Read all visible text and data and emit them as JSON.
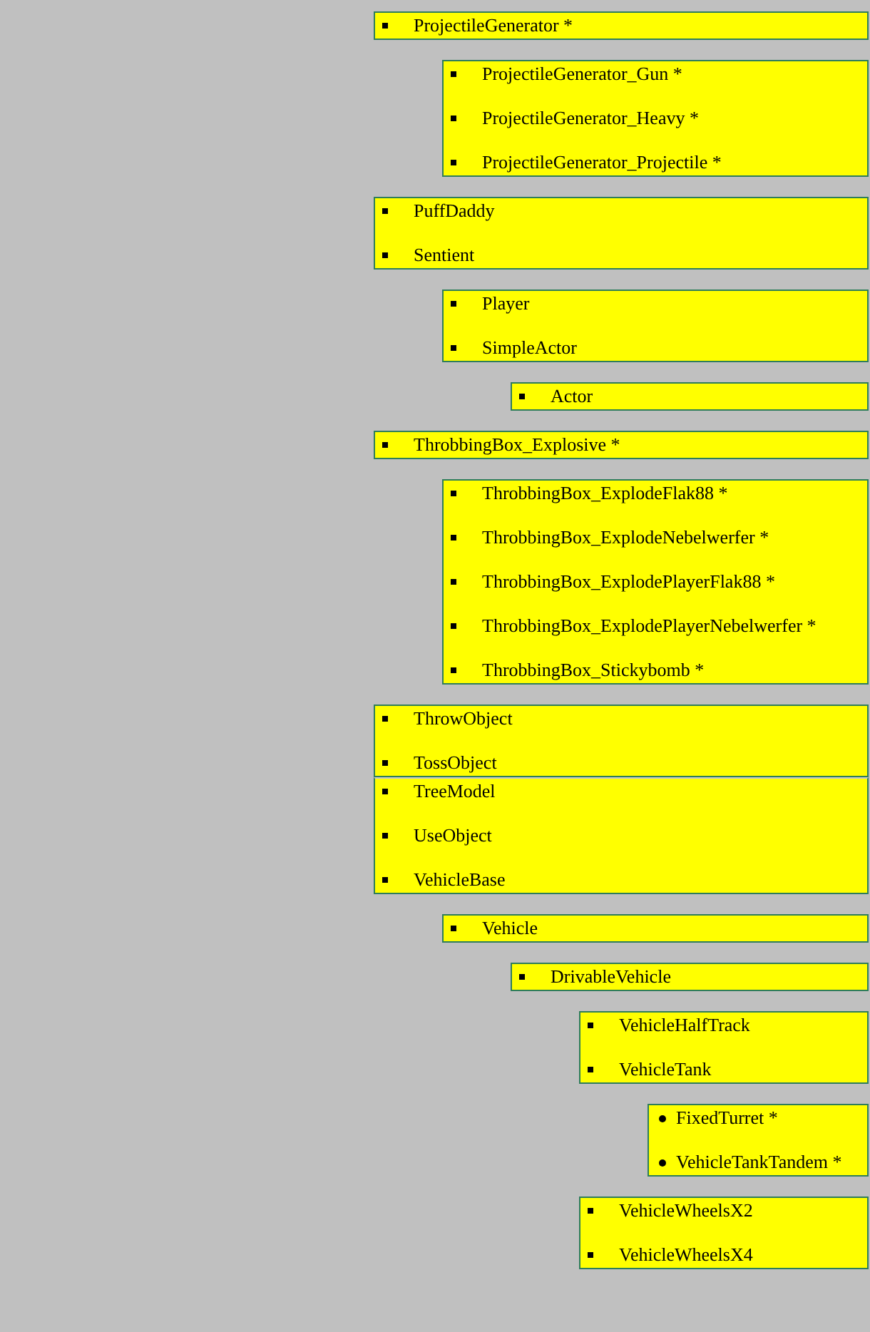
{
  "boxes": [
    {
      "kind": "square",
      "attached": false,
      "items": [
        "ProjectileGenerator *"
      ],
      "children": [
        {
          "kind": "square",
          "attached": false,
          "items": [
            "ProjectileGenerator_Gun *",
            "ProjectileGenerator_Heavy *",
            "ProjectileGenerator_Projectile *"
          ]
        }
      ]
    },
    {
      "kind": "square",
      "attached": false,
      "items": [
        "PuffDaddy",
        "Sentient"
      ],
      "children": [
        {
          "kind": "square",
          "attached": false,
          "items": [
            "Player",
            "SimpleActor"
          ],
          "children": [
            {
              "kind": "square",
              "attached": false,
              "items": [
                "Actor"
              ]
            }
          ]
        }
      ]
    },
    {
      "kind": "square",
      "attached": false,
      "items": [
        "ThrobbingBox_Explosive *"
      ],
      "children": [
        {
          "kind": "square",
          "attached": false,
          "items": [
            "ThrobbingBox_ExplodeFlak88 *",
            "ThrobbingBox_ExplodeNebelwerfer *",
            "ThrobbingBox_ExplodePlayerFlak88 *",
            "ThrobbingBox_ExplodePlayerNebelwerfer *",
            "ThrobbingBox_Stickybomb *"
          ]
        }
      ]
    },
    {
      "kind": "square",
      "attached": false,
      "items": [
        "ThrowObject",
        "TossObject"
      ]
    },
    {
      "kind": "square",
      "attached": true,
      "items": [
        "TreeModel",
        "UseObject",
        "VehicleBase"
      ],
      "children": [
        {
          "kind": "square",
          "attached": false,
          "items": [
            "Vehicle"
          ],
          "children": [
            {
              "kind": "square",
              "attached": false,
              "items": [
                "DrivableVehicle"
              ],
              "children": [
                {
                  "kind": "square",
                  "attached": false,
                  "items": [
                    "VehicleHalfTrack",
                    "VehicleTank"
                  ],
                  "children": [
                    {
                      "kind": "disc",
                      "attached": false,
                      "items": [
                        "FixedTurret *",
                        "VehicleTankTandem *"
                      ]
                    }
                  ]
                },
                {
                  "kind": "square",
                  "attached": false,
                  "items": [
                    "VehicleWheelsX2",
                    "VehicleWheelsX4"
                  ]
                }
              ]
            }
          ]
        }
      ]
    }
  ]
}
